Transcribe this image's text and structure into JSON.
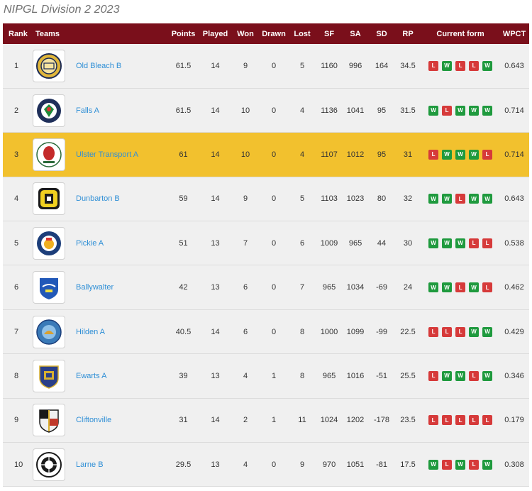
{
  "title": "NIPGL Division 2 2023",
  "headers": {
    "rank": "Rank",
    "teams": "Teams",
    "points": "Points",
    "played": "Played",
    "won": "Won",
    "drawn": "Drawn",
    "lost": "Lost",
    "sf": "SF",
    "sa": "SA",
    "sd": "SD",
    "rp": "RP",
    "form": "Current form",
    "wpct": "WPCT"
  },
  "colors": {
    "header_bg": "#7a0f1b",
    "highlight_row": "#f2c12e",
    "win": "#1f9a3e",
    "loss": "#d63a3a",
    "link": "#2f8fd6"
  },
  "rows": [
    {
      "rank": "1",
      "team": "Old Bleach B",
      "logo": "old-bleach-logo",
      "points": "61.5",
      "played": "14",
      "won": "9",
      "drawn": "0",
      "lost": "5",
      "sf": "1160",
      "sa": "996",
      "sd": "164",
      "rp": "34.5",
      "form": [
        "L",
        "W",
        "L",
        "L",
        "W"
      ],
      "wpct": "0.643"
    },
    {
      "rank": "2",
      "team": "Falls A",
      "logo": "falls-logo",
      "points": "61.5",
      "played": "14",
      "won": "10",
      "drawn": "0",
      "lost": "4",
      "sf": "1136",
      "sa": "1041",
      "sd": "95",
      "rp": "31.5",
      "form": [
        "W",
        "L",
        "W",
        "W",
        "W"
      ],
      "wpct": "0.714"
    },
    {
      "rank": "3",
      "team": "Ulster Transport A",
      "logo": "ulster-transport-logo",
      "points": "61",
      "played": "14",
      "won": "10",
      "drawn": "0",
      "lost": "4",
      "sf": "1107",
      "sa": "1012",
      "sd": "95",
      "rp": "31",
      "form": [
        "L",
        "W",
        "W",
        "W",
        "L"
      ],
      "wpct": "0.714",
      "highlight": true
    },
    {
      "rank": "4",
      "team": "Dunbarton B",
      "logo": "dunbarton-logo",
      "points": "59",
      "played": "14",
      "won": "9",
      "drawn": "0",
      "lost": "5",
      "sf": "1103",
      "sa": "1023",
      "sd": "80",
      "rp": "32",
      "form": [
        "W",
        "W",
        "L",
        "W",
        "W"
      ],
      "wpct": "0.643"
    },
    {
      "rank": "5",
      "team": "Pickie A",
      "logo": "pickie-logo",
      "points": "51",
      "played": "13",
      "won": "7",
      "drawn": "0",
      "lost": "6",
      "sf": "1009",
      "sa": "965",
      "sd": "44",
      "rp": "30",
      "form": [
        "W",
        "W",
        "W",
        "L",
        "L"
      ],
      "wpct": "0.538"
    },
    {
      "rank": "6",
      "team": "Ballywalter",
      "logo": "ballywalter-logo",
      "points": "42",
      "played": "13",
      "won": "6",
      "drawn": "0",
      "lost": "7",
      "sf": "965",
      "sa": "1034",
      "sd": "-69",
      "rp": "24",
      "form": [
        "W",
        "W",
        "L",
        "W",
        "L"
      ],
      "wpct": "0.462"
    },
    {
      "rank": "7",
      "team": "Hilden A",
      "logo": "hilden-logo",
      "points": "40.5",
      "played": "14",
      "won": "6",
      "drawn": "0",
      "lost": "8",
      "sf": "1000",
      "sa": "1099",
      "sd": "-99",
      "rp": "22.5",
      "form": [
        "L",
        "L",
        "L",
        "W",
        "W"
      ],
      "wpct": "0.429"
    },
    {
      "rank": "8",
      "team": "Ewarts A",
      "logo": "ewarts-logo",
      "points": "39",
      "played": "13",
      "won": "4",
      "drawn": "1",
      "lost": "8",
      "sf": "965",
      "sa": "1016",
      "sd": "-51",
      "rp": "25.5",
      "form": [
        "L",
        "W",
        "W",
        "L",
        "W"
      ],
      "wpct": "0.346"
    },
    {
      "rank": "9",
      "team": "Cliftonville",
      "logo": "cliftonville-logo",
      "points": "31",
      "played": "14",
      "won": "2",
      "drawn": "1",
      "lost": "11",
      "sf": "1024",
      "sa": "1202",
      "sd": "-178",
      "rp": "23.5",
      "form": [
        "L",
        "L",
        "L",
        "L",
        "L"
      ],
      "wpct": "0.179"
    },
    {
      "rank": "10",
      "team": "Larne B",
      "logo": "larne-logo",
      "points": "29.5",
      "played": "13",
      "won": "4",
      "drawn": "0",
      "lost": "9",
      "sf": "970",
      "sa": "1051",
      "sd": "-81",
      "rp": "17.5",
      "form": [
        "W",
        "L",
        "W",
        "L",
        "W"
      ],
      "wpct": "0.308"
    }
  ]
}
